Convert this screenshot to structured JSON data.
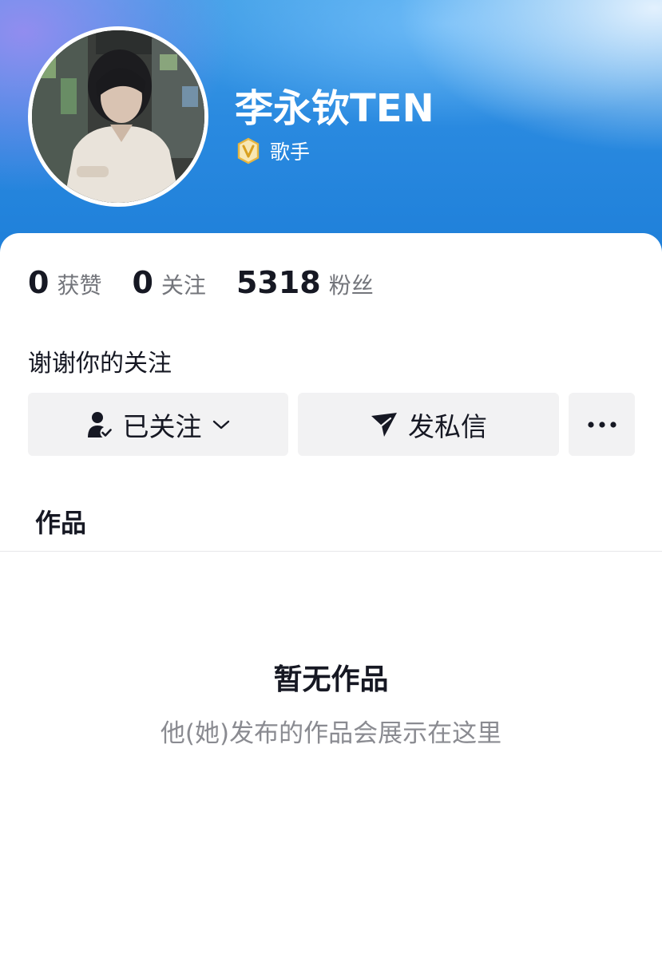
{
  "profile": {
    "name": "李永钦TEN",
    "verification_label": "歌手",
    "verification_icon": "v-badge-icon",
    "avatar_icon": "avatar-photo"
  },
  "stats": [
    {
      "count": "0",
      "label": "获赞"
    },
    {
      "count": "0",
      "label": "关注"
    },
    {
      "count": "5318",
      "label": "粉丝"
    }
  ],
  "bio": "谢谢你的关注",
  "actions": {
    "follow_label": "已关注",
    "follow_icon": "user-check-icon",
    "follow_dropdown_icon": "chevron-down-icon",
    "message_label": "发私信",
    "message_icon": "paper-plane-icon",
    "more_icon": "more-dots-icon"
  },
  "tabs": {
    "works_label": "作品"
  },
  "empty_state": {
    "title": "暂无作品",
    "subtitle": "他(她)发布的作品会展示在这里"
  },
  "colors": {
    "header_blue": "#2a8ae0",
    "button_bg": "#f2f2f3",
    "badge_gold": "#e7b640",
    "text_primary": "#161823",
    "text_secondary": "#73757b"
  }
}
